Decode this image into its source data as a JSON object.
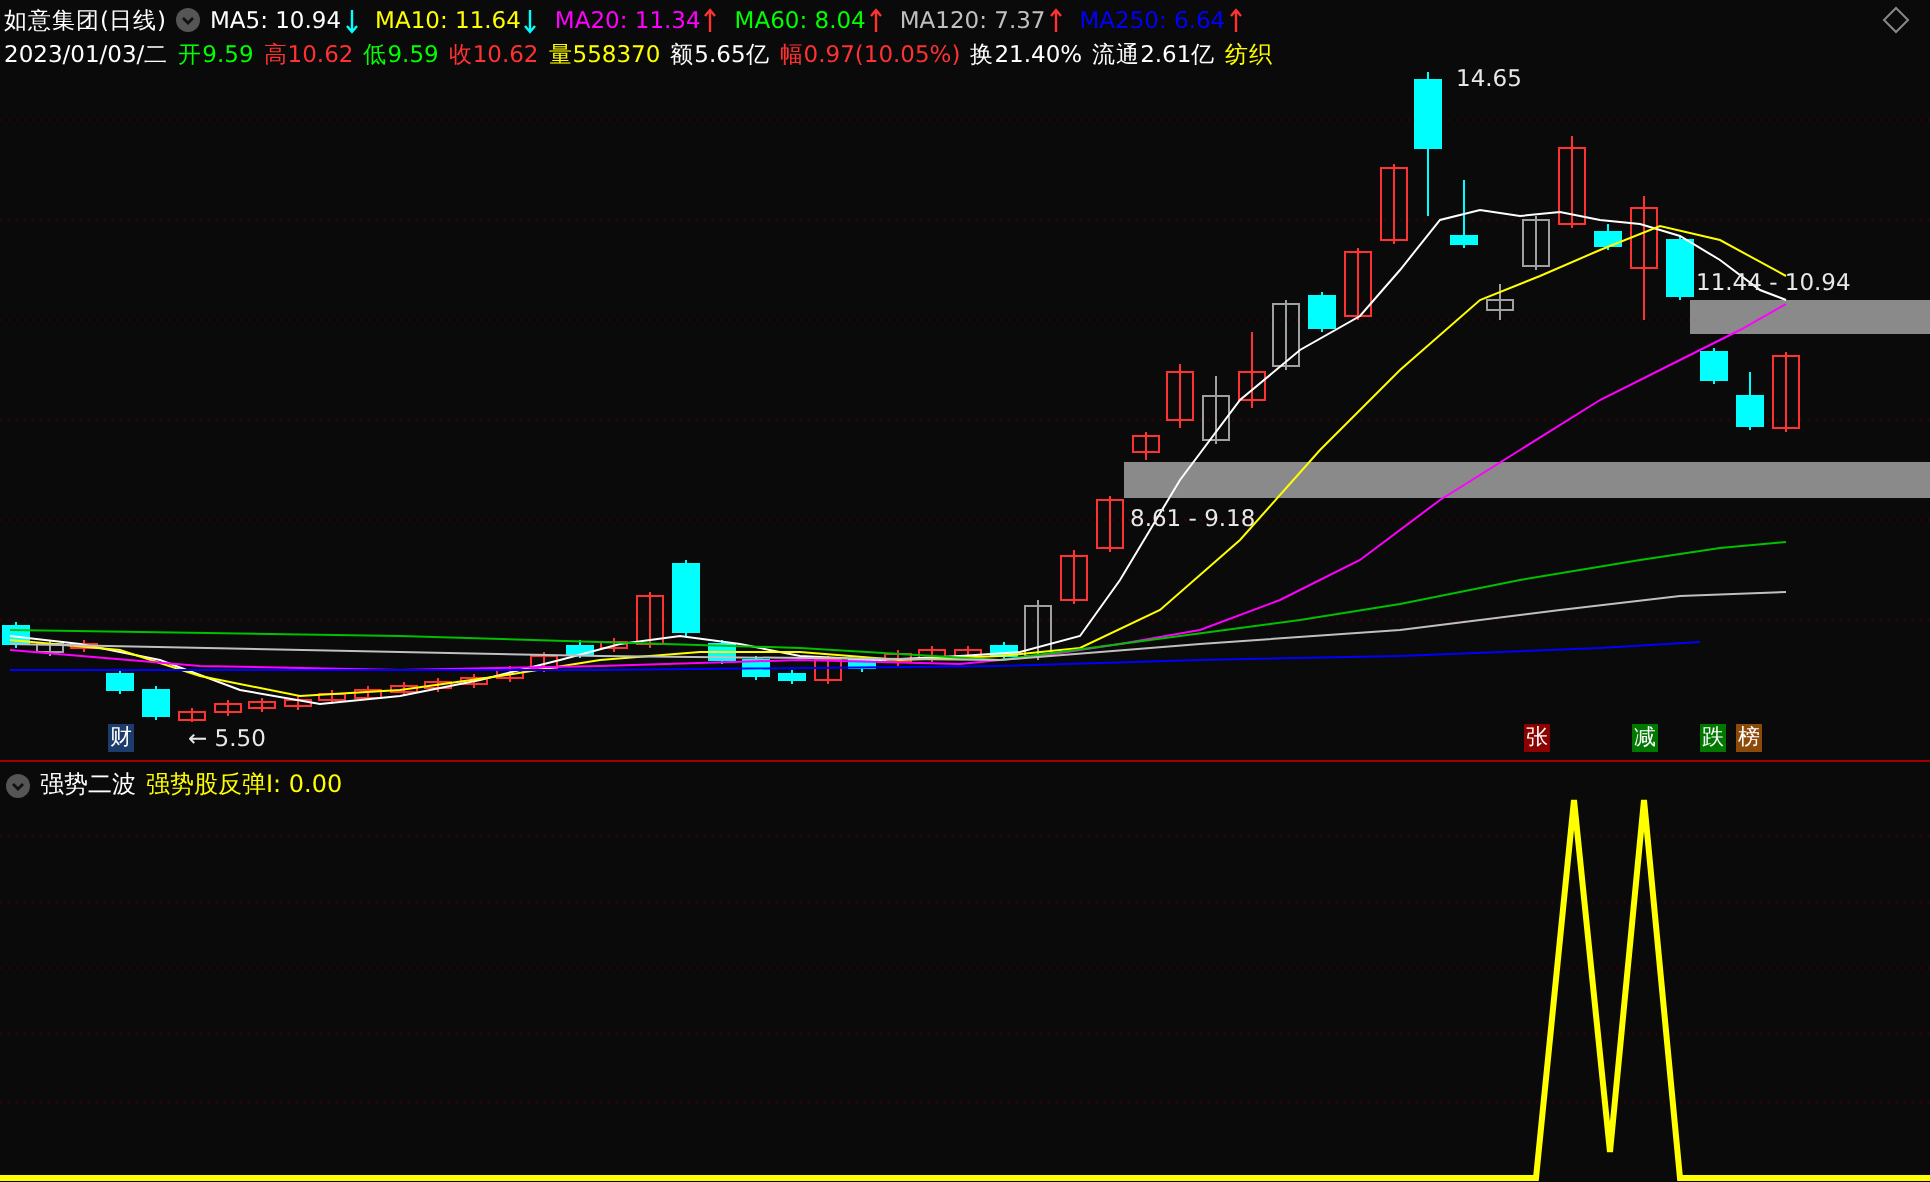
{
  "header": {
    "title": "如意集团(日线)",
    "ma": [
      {
        "label": "MA5: 10.94",
        "color": "#ffffff",
        "kind": "down"
      },
      {
        "label": "MA10: 11.64",
        "color": "#ffff00",
        "kind": "down"
      },
      {
        "label": "MA20: 11.34",
        "color": "#ff00ff",
        "kind": "up"
      },
      {
        "label": "MA60: 8.04",
        "color": "#00ff00",
        "kind": "up"
      },
      {
        "label": "MA120: 7.37",
        "color": "#c0c0c0",
        "kind": "up"
      },
      {
        "label": "MA250: 6.64",
        "color": "#0000ff",
        "kind": "up"
      }
    ],
    "info": [
      {
        "text": "2023/01/03/二",
        "color": "#ffffff"
      },
      {
        "text": "开9.59",
        "color": "#00ff00"
      },
      {
        "text": "高10.62",
        "color": "#ff3232"
      },
      {
        "text": "低9.59",
        "color": "#00ff00"
      },
      {
        "text": "收10.62",
        "color": "#ff3232"
      },
      {
        "text": "量558370",
        "color": "#ffff00"
      },
      {
        "text": "额5.65亿",
        "color": "#ffffff"
      },
      {
        "text": "幅0.97(10.05%)",
        "color": "#ff3232"
      },
      {
        "text": "换21.40%",
        "color": "#ffffff"
      },
      {
        "text": "流通2.61亿",
        "color": "#ffffff"
      },
      {
        "text": "纺织",
        "color": "#ffff00"
      }
    ]
  },
  "chart": {
    "labels": [
      {
        "text": "14.65",
        "kind": "high"
      },
      {
        "text": "← 5.50",
        "kind": "low"
      },
      {
        "text": "8.61 - 9.18",
        "kind": "band_low"
      },
      {
        "text": "11.44 - 10.94",
        "kind": "band_high"
      }
    ],
    "markers": [
      {
        "text": "财",
        "color": "#1c3c6c"
      },
      {
        "text": "张",
        "color": "#8b0000"
      },
      {
        "text": "减",
        "color": "#007800"
      },
      {
        "text": "跌",
        "color": "#007800"
      },
      {
        "text": "榜",
        "color": "#8b4a0a"
      }
    ]
  },
  "indicator": {
    "name": "强势二波",
    "value": "强势股反弹I: 0.00"
  }
}
